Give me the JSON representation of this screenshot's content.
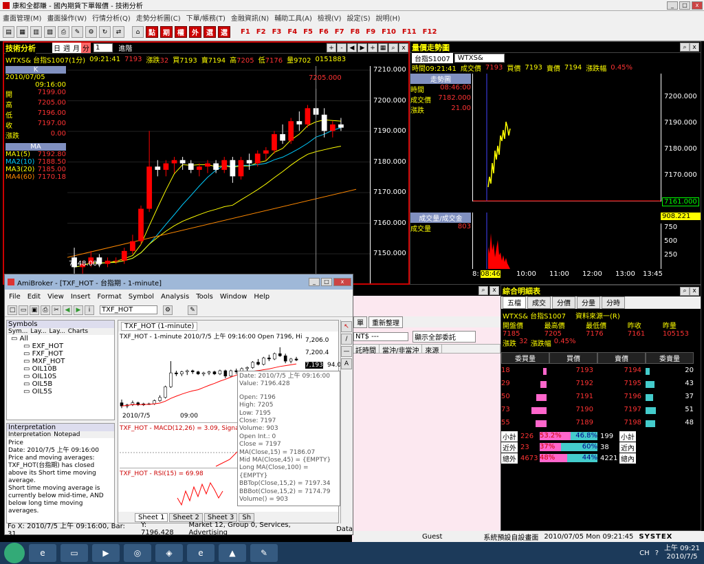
{
  "app": {
    "title": "康和全都賺 - 國內期貨下單報價 - 技術分析"
  },
  "menu": [
    "畫面管理(M)",
    "畫面操作(W)",
    "行情分析(Q)",
    "走勢分析圖(C)",
    "下單/帳務(T)",
    "金融資訊(N)",
    "輔助工具(A)",
    "檢視(V)",
    "設定(S)",
    "說明(H)"
  ],
  "toolbar": {
    "redbtns": [
      "點",
      "期",
      "權",
      "外",
      "選",
      "選"
    ],
    "fkeys": [
      "F1",
      "F2",
      "F3",
      "F4",
      "F5",
      "F6",
      "F7",
      "F8",
      "F9",
      "F10",
      "F11",
      "F12"
    ]
  },
  "ta": {
    "title": "技術分析",
    "period": "日",
    "period2": "週",
    "period3": "月",
    "period4": "分",
    "sel": "1",
    "mode": "進階",
    "sym": "WTXS&  台指S1007(1分)",
    "time": "09:21:41",
    "p1": "7193",
    "lbl_chg": "漲跌",
    "chg": "32",
    "lbl_buy": "買",
    "buy": "7193",
    "lbl_sell": "賣",
    "sell": "7194",
    "lbl_hi": "高",
    "hi": "7205",
    "lbl_lo": "低",
    "lo": "7176",
    "lbl_vol": "量",
    "vol": "9702",
    "seq": "0151883",
    "kbox": {
      "title": "K",
      "date": "2010/07/05",
      "time": "09:16:00",
      "rows": [
        [
          "開",
          "7199.00"
        ],
        [
          "高",
          "7205.00"
        ],
        [
          "低",
          "7196.00"
        ],
        [
          "收",
          "7197.00"
        ],
        [
          "漲跌",
          "0.00"
        ]
      ]
    },
    "mabox": {
      "title": "MA",
      "rows": [
        [
          "MA1(5)",
          "7192.80"
        ],
        [
          "MA2(10)",
          "7188.50"
        ],
        [
          "MA3(20)",
          "7185.00"
        ],
        [
          "MA4(60)",
          "7170.18"
        ]
      ]
    },
    "yaxis": [
      "7210.000",
      "7200.000",
      "7190.000",
      "7180.000",
      "7170.000",
      "7160.000",
      "7150.000"
    ],
    "hi_lbl": "7205.000",
    "lo_lbl": "7148.000"
  },
  "tt": {
    "title": "量價走勢圖",
    "sym": "台指S1007",
    "code": "WTXS&",
    "time": "時間09:21:41",
    "lbl_deal": "成交價",
    "deal": "7193",
    "lbl_buy": "買價",
    "buy": "7193",
    "lbl_sell": "賣價",
    "sell": "7194",
    "lbl_amp": "漲跌幅",
    "amp": "0.45%",
    "box": {
      "title": "走勢圖",
      "rows": [
        [
          "時間",
          "08:46:00"
        ],
        [
          "成交價",
          "7182.000"
        ],
        [
          "漲跌",
          "21.00"
        ]
      ]
    },
    "yaxis": [
      "7200.000",
      "7190.000",
      "7180.000",
      "7170.000"
    ],
    "cur": "7161.000",
    "volbox": {
      "title": "成交量/成交金",
      "lbl": "成交量",
      "val": "803"
    },
    "vtop": "908.221",
    "vaxis": [
      "750",
      "500",
      "250"
    ],
    "xaxis": [
      "8:",
      "08:46",
      "10:00",
      "11:00",
      "12:00",
      "13:00",
      "13:45"
    ]
  },
  "summary": {
    "title": "綜合明細表",
    "tabs": [
      "五檔",
      "成交",
      "分價",
      "分量",
      "分時"
    ],
    "sym": "WTXS&  台指S1007",
    "src": "資料來源一(R)",
    "r1": [
      [
        "開盤價",
        "7185"
      ],
      [
        "最高價",
        "7205"
      ],
      [
        "最低價",
        "7176"
      ],
      [
        "昨收",
        "7161"
      ],
      [
        "昨量",
        "105153"
      ]
    ],
    "chg_lbl": "漲跌",
    "chg": "32",
    "amp_lbl": "漲跌幅",
    "amp": "0.45%",
    "cols": [
      "委買量",
      "買價",
      "賣價",
      "委賣量"
    ],
    "rows": [
      [
        "18",
        "7193",
        "7194",
        "20"
      ],
      [
        "29",
        "7192",
        "7195",
        "43"
      ],
      [
        "50",
        "7191",
        "7196",
        "37"
      ],
      [
        "73",
        "7190",
        "7197",
        "51"
      ],
      [
        "55",
        "7189",
        "7198",
        "48"
      ]
    ],
    "foot": [
      [
        "小計",
        "226",
        "53.2%",
        "46.8%",
        "199",
        "小計"
      ],
      [
        "近外",
        "23",
        "37%",
        "60%",
        "38",
        "近內"
      ],
      [
        "總外",
        "4673",
        "48%",
        "44%",
        "4221",
        "總內"
      ]
    ]
  },
  "order": {
    "btn": "重新整理",
    "sel": "NT$ ---",
    "sel2": "顯示全部委託",
    "cols": [
      "託時間",
      "當沖/非當沖",
      "來源"
    ]
  },
  "ab": {
    "title": "AmiBroker - [TXF_HOT - 台指期 - 1-minute]",
    "menu": [
      "File",
      "Edit",
      "View",
      "Insert",
      "Format",
      "Symbol",
      "Analysis",
      "Tools",
      "Window",
      "Help"
    ],
    "symcombo": "TXF_HOT",
    "sympanel": "Symbols",
    "symtabs": [
      "Sym...",
      "Lay...",
      "Lay...",
      "Charts"
    ],
    "tree": [
      "All",
      "EXF_HOT",
      "FXF_HOT",
      "MXF_HOT",
      "OIL10B",
      "OIL10S",
      "OIL5B",
      "OIL5S"
    ],
    "interp": "Interpretation",
    "interptabs": [
      "Interpretation",
      "Notepad"
    ],
    "interptext": [
      "Price",
      "Date: 2010/7/5 上午 09:16:00",
      "Price and moving averages:",
      "TXF_HOT(台指期) has closed above its Short time moving average.",
      "Short time moving average is currently below mid-time, AND below long time moving averages."
    ],
    "charttab": "TXF_HOT (1-minute)",
    "charthdr": "TXF_HOT - 1-minute 2010/7/5 上午 09:16:00 Open 7196, Hi",
    "cy": [
      "7,206.0",
      "7,200.4",
      "7,193"
    ],
    "cyn": "94.0",
    "xlabels": [
      "2010/7/5",
      "09:00"
    ],
    "macd": "TXF_HOT - MACD(12,26) = 3.09, Signa",
    "rsi": "TXF_HOT - RSI(15) = 69.98",
    "tip": [
      "Date: 2010/7/5 上午 09:16:00",
      "Value: 7196.428",
      "",
      "Open: 7196",
      "High: 7205",
      "Low:  7195",
      "Close: 7197",
      "Volume: 903",
      "Open Int.: 0",
      "Close = 7197",
      "MA(Close,15) = 7186.07",
      "Mid MA(Close,45) = {EMPTY}",
      "Long MA(Close,100) = {EMPTY}",
      "BBTop(Close,15,2) = 7197.34",
      "BBBot(Close,15,2) = 7174.79",
      "Volume() = 903"
    ],
    "sheets": [
      "Sheet 1",
      "Sheet 2",
      "Sheet 3",
      "Sh"
    ],
    "status": [
      "Fo X: 2010/7/5 上午 09:16:00, Bar: 31",
      "Y: 7196.428",
      "Market 12, Group 0, Services, Advertising",
      "Data"
    ]
  },
  "statusbar": {
    "user": "Guest",
    "layout": "系統預設自設畫面",
    "dt": "2010/07/05 Mon 09:21:45",
    "brand": "SYSTEX"
  },
  "clock": {
    "time": "上午 09:21",
    "date": "2010/7/5",
    "lang": "CH"
  },
  "chart_data": {
    "type": "candlestick",
    "title": "台指S1007(1分)",
    "ylim": [
      7145,
      7212
    ],
    "candles": [
      [
        7153,
        7156,
        7148,
        7150
      ],
      [
        7150,
        7152,
        7148,
        7151
      ],
      [
        7151,
        7155,
        7150,
        7153
      ],
      [
        7153,
        7154,
        7150,
        7151
      ],
      [
        7151,
        7153,
        7150,
        7152
      ],
      [
        7152,
        7153,
        7151,
        7152
      ],
      [
        7152,
        7156,
        7151,
        7155
      ],
      [
        7155,
        7160,
        7154,
        7158
      ],
      [
        7158,
        7169,
        7157,
        7168
      ],
      [
        7168,
        7192,
        7167,
        7181
      ],
      [
        7181,
        7183,
        7178,
        7180
      ],
      [
        7180,
        7183,
        7178,
        7182
      ],
      [
        7182,
        7184,
        7179,
        7183
      ],
      [
        7183,
        7184,
        7180,
        7182
      ],
      [
        7182,
        7183,
        7179,
        7180
      ],
      [
        7180,
        7182,
        7178,
        7181
      ],
      [
        7181,
        7183,
        7179,
        7182
      ],
      [
        7182,
        7183,
        7179,
        7180
      ],
      [
        7180,
        7184,
        7179,
        7183
      ],
      [
        7183,
        7184,
        7176,
        7178
      ],
      [
        7178,
        7184,
        7177,
        7183
      ],
      [
        7183,
        7185,
        7180,
        7182
      ],
      [
        7182,
        7186,
        7181,
        7185
      ],
      [
        7185,
        7187,
        7183,
        7186
      ],
      [
        7186,
        7192,
        7185,
        7191
      ],
      [
        7191,
        7194,
        7188,
        7189
      ],
      [
        7189,
        7196,
        7188,
        7195
      ],
      [
        7195,
        7198,
        7192,
        7194
      ],
      [
        7194,
        7200,
        7193,
        7199
      ],
      [
        7199,
        7205,
        7196,
        7197
      ],
      [
        7197,
        7199,
        7190,
        7192
      ],
      [
        7192,
        7195,
        7190,
        7194
      ],
      [
        7194,
        7196,
        7192,
        7193
      ]
    ]
  }
}
